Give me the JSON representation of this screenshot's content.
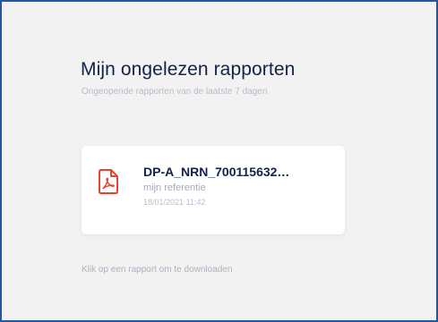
{
  "header": {
    "title": "Mijn ongelezen rapporten",
    "subtitle": "Ongeopende rapporten van de laatste 7 dagen"
  },
  "reports": [
    {
      "name": "DP-A_NRN_700115632…",
      "reference": "mijn referentie",
      "date": "18/01/2021 11:42",
      "icon": "pdf-file-icon"
    }
  ],
  "footer": {
    "hint": "Klik op een rapport om te downloaden"
  },
  "colors": {
    "frame_border": "#1f57a6",
    "background": "#f2f2f2",
    "title": "#14224a",
    "pdf_icon": "#e8432f"
  }
}
